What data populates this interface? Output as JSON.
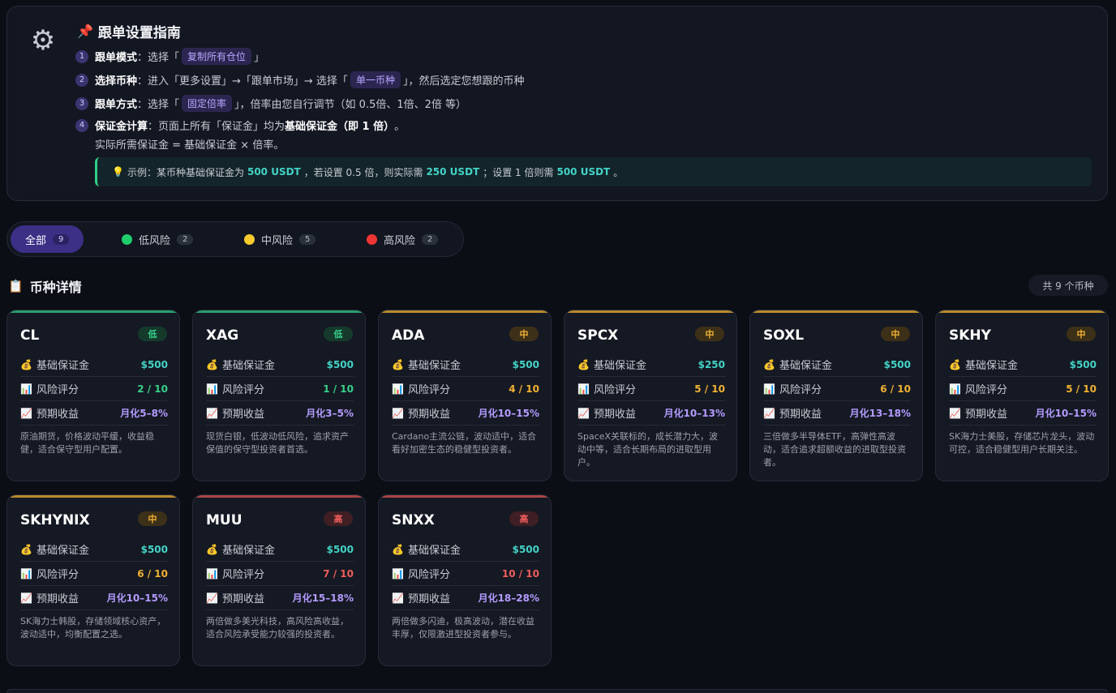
{
  "guide": {
    "title": "跟单设置指南",
    "steps": [
      {
        "num": "1",
        "label": "跟单模式",
        "pre": "：选择「",
        "tag": "复制所有仓位",
        "post": "」"
      },
      {
        "num": "2",
        "label": "选择币种",
        "pre": "：进入「更多设置」→「跟单市场」→ 选择「",
        "tag": "单一币种",
        "post": "」，然后选定您想跟的币种"
      },
      {
        "num": "3",
        "label": "跟单方式",
        "pre": "：选择「",
        "tag": "固定倍率",
        "post": "」，倍率由您自行调节（如 0.5倍、1倍、2倍 等）"
      },
      {
        "num": "4",
        "label": "保证金计算",
        "pre": "：页面上所有「保证金」均为 ",
        "bold": "基础保证金（即 1 倍）",
        "post": "。"
      }
    ],
    "sub_note": "实际所需保证金 = 基础保证金 × 倍率。",
    "tip": {
      "t1": "示例：某币种基础保证金为",
      "v1": "500 USDT",
      "t2": "，若设置 0.5 倍，则实际需",
      "v2": "250 USDT",
      "t3": "；设置 1 倍则需",
      "v3": "500 USDT",
      "t4": "。"
    }
  },
  "filters": [
    {
      "label": "全部",
      "count": "9",
      "active": true
    },
    {
      "label": "低风险",
      "count": "2",
      "color": "#1fce6b"
    },
    {
      "label": "中风险",
      "count": "5",
      "color": "#f7cb2e"
    },
    {
      "label": "高风险",
      "count": "2",
      "color": "#ee3535"
    }
  ],
  "section": {
    "title": "币种详情",
    "count_text": "共 9 个币种"
  },
  "field_labels": {
    "margin": "基础保证金",
    "risk": "风险评分",
    "yield": "预期收益"
  },
  "coins": [
    {
      "symbol": "CL",
      "risk": "低",
      "level": "low",
      "margin": "$500",
      "score": "2 / 10",
      "yield": "月化5–8%",
      "desc": "原油期货，价格波动平缓，收益稳健，适合保守型用户配置。"
    },
    {
      "symbol": "XAG",
      "risk": "低",
      "level": "low",
      "margin": "$500",
      "score": "1 / 10",
      "yield": "月化3–5%",
      "desc": "现货白银，低波动低风险，追求资产保值的保守型投资者首选。"
    },
    {
      "symbol": "ADA",
      "risk": "中",
      "level": "mid",
      "margin": "$500",
      "score": "4 / 10",
      "yield": "月化10–15%",
      "desc": "Cardano主流公链，波动适中，适合看好加密生态的稳健型投资者。"
    },
    {
      "symbol": "SPCX",
      "risk": "中",
      "level": "mid",
      "margin": "$250",
      "score": "5 / 10",
      "yield": "月化10–13%",
      "desc": "SpaceX关联标的，成长潜力大，波动中等，适合长期布局的进取型用户。"
    },
    {
      "symbol": "SOXL",
      "risk": "中",
      "level": "mid",
      "margin": "$500",
      "score": "6 / 10",
      "yield": "月化13–18%",
      "desc": "三倍做多半导体ETF，高弹性高波动，适合追求超额收益的进取型投资者。"
    },
    {
      "symbol": "SKHY",
      "risk": "中",
      "level": "mid",
      "margin": "$500",
      "score": "5 / 10",
      "yield": "月化10–15%",
      "desc": "SK海力士美股，存储芯片龙头，波动可控，适合稳健型用户长期关注。"
    },
    {
      "symbol": "SKHYNIX",
      "risk": "中",
      "level": "mid",
      "margin": "$500",
      "score": "6 / 10",
      "yield": "月化10–15%",
      "desc": "SK海力士韩股，存储领域核心资产，波动适中，均衡配置之选。"
    },
    {
      "symbol": "MUU",
      "risk": "高",
      "level": "high",
      "margin": "$500",
      "score": "7 / 10",
      "yield": "月化15–18%",
      "desc": "两倍做多美光科技，高风险高收益，适合风险承受能力较强的投资者。"
    },
    {
      "symbol": "SNXX",
      "risk": "高",
      "level": "high",
      "margin": "$500",
      "score": "10 / 10",
      "yield": "月化18–28%",
      "desc": "两倍做多闪迪，极高波动，潜在收益丰厚，仅限激进型投资者参与。"
    }
  ],
  "colors": {
    "low_accent": "#2a9d6e",
    "mid_accent": "#b88a2e",
    "high_accent": "#a84545"
  }
}
